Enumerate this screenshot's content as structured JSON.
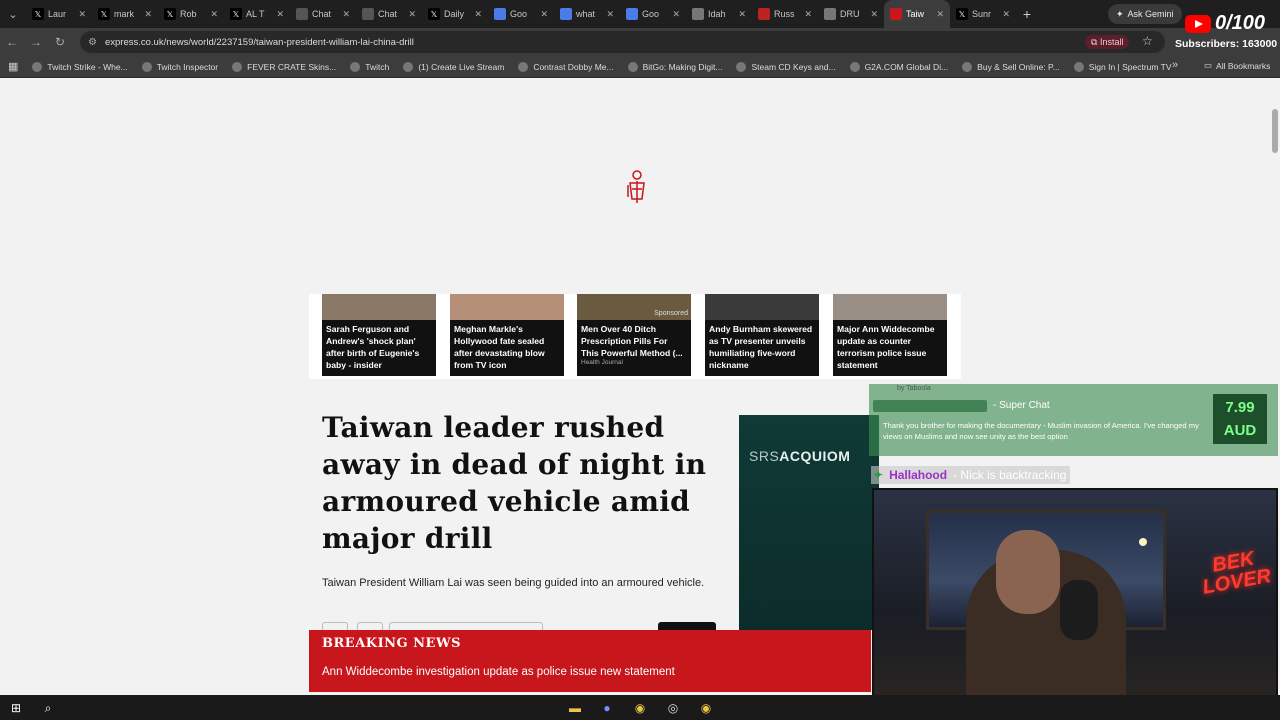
{
  "browser": {
    "tabs": [
      {
        "label": "Laur",
        "icon": "x-icon",
        "active": false
      },
      {
        "label": "mark",
        "icon": "x-icon",
        "active": false
      },
      {
        "label": "Rob",
        "icon": "x-icon",
        "active": false
      },
      {
        "label": "AL T",
        "icon": "x-icon",
        "active": false
      },
      {
        "label": "Chat",
        "icon": "chatgpt-icon",
        "active": false
      },
      {
        "label": "Chat",
        "icon": "chatgpt-icon",
        "active": false
      },
      {
        "label": "Daily",
        "icon": "x-icon",
        "active": false
      },
      {
        "label": "Goo",
        "icon": "google-icon",
        "active": false
      },
      {
        "label": "what",
        "icon": "google-icon",
        "active": false
      },
      {
        "label": "Goo",
        "icon": "google-icon",
        "active": false
      },
      {
        "label": "Idah",
        "icon": "globe-icon",
        "active": false
      },
      {
        "label": "Russ",
        "icon": "rt-icon",
        "active": false
      },
      {
        "label": "DRU",
        "icon": "globe-icon",
        "active": false
      },
      {
        "label": "Taiw",
        "icon": "express-icon",
        "active": true
      },
      {
        "label": "Sunr",
        "icon": "x-icon",
        "active": false
      }
    ],
    "gemini_label": "Ask Gemini",
    "url": "express.co.uk/news/world/2237159/taiwan-president-william-lai-china-drill",
    "install_label": "Install",
    "bookmarks": [
      "Twitch Strike - Whe...",
      "Twitch Inspector",
      "FEVER CRATE Skins...",
      "Twitch",
      "(1) Create Live Stream",
      "Contrast Dobby Me...",
      "BitGo: Making Digit...",
      "Steam CD Keys and...",
      "G2A.COM Global Di...",
      "Buy & Sell Online: P...",
      "Sign In | Spectrum TV"
    ],
    "all_bookmarks_label": "All Bookmarks"
  },
  "article": {
    "promo_cards": [
      {
        "title": "Sarah Ferguson and Andrew's 'shock plan' after birth of Eugenie's baby - insider",
        "sponsored": "",
        "source": ""
      },
      {
        "title": "Meghan Markle's Hollywood fate sealed after devastating blow from TV icon",
        "sponsored": "",
        "source": ""
      },
      {
        "title": "Men Over 40 Ditch Prescription Pills For This Powerful Method (...",
        "sponsored": "Sponsored",
        "source": "Health Journal"
      },
      {
        "title": "Andy Burnham skewered as TV presenter unveils humiliating five-word nickname",
        "sponsored": "",
        "source": ""
      },
      {
        "title": "Major Ann Widdecombe update as counter terrorism police issue statement",
        "sponsored": "",
        "source": ""
      }
    ],
    "taboola_label": "by Taboola",
    "headline": "Taiwan leader rushed away in dead of night in armoured vehicle amid major drill",
    "standfirst": "Taiwan President William Lai was seen being guided into an armoured vehicle.",
    "ad_brand_light": "SRS",
    "ad_brand_bold": "ACQUIOM",
    "breaking_label": "BREAKING NEWS",
    "breaking_text": "Ann Widdecombe investigation update as police issue new statement"
  },
  "stream": {
    "subscriber_count": "0/100",
    "subscriber_label": "Subscribers: 163000",
    "superchat_label": "- Super Chat",
    "superchat_message": "Thank you brother for making the documentary - Muslim invasion of America. I've changed my views on Muslims and now see unity as the best option",
    "superchat_amount": "7.99",
    "superchat_currency": "AUD",
    "chat_user": "Hallahood",
    "chat_text": "- Nick is backtracking",
    "neon_sign": "BEK LOVER"
  },
  "colors": {
    "breaking_red": "#c8161d",
    "superchat_green": "#3c8c50",
    "chat_name": "#9b30c8"
  }
}
